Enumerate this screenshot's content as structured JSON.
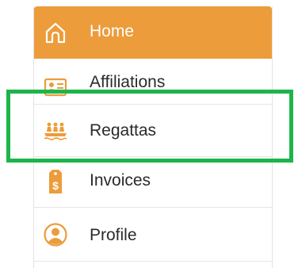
{
  "menu": {
    "items": [
      {
        "label": "Home",
        "icon": "home-icon",
        "active": true
      },
      {
        "label": "Affiliations",
        "icon": "id-card-icon",
        "active": false
      },
      {
        "label": "Regattas",
        "icon": "rowing-icon",
        "active": false
      },
      {
        "label": "Invoices",
        "icon": "price-tag-dollar-icon",
        "active": false
      },
      {
        "label": "Profile",
        "icon": "user-circle-icon",
        "active": false
      }
    ]
  },
  "colors": {
    "accent": "#ec9c3a",
    "highlight": "#1db54a",
    "text": "#2a2a2a"
  }
}
